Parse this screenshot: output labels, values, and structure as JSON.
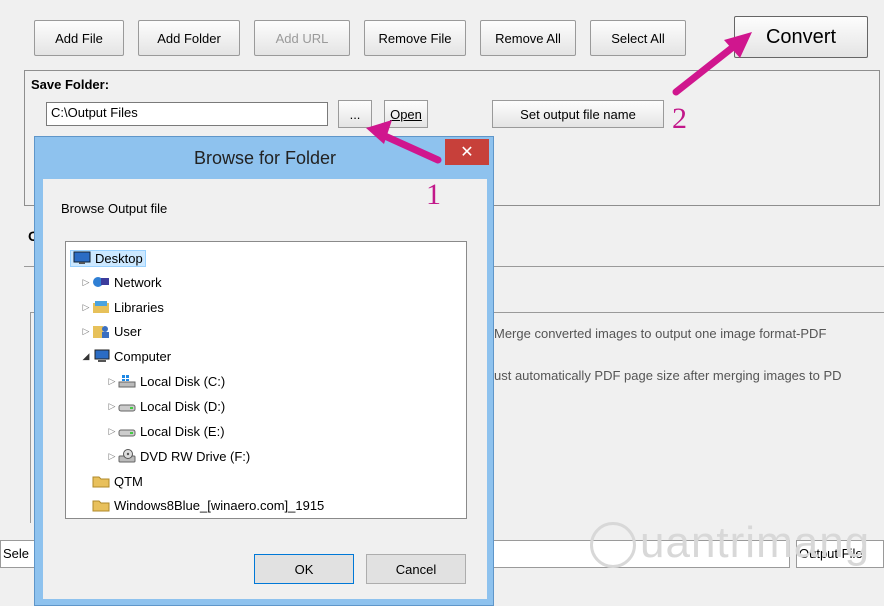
{
  "toolbar": {
    "add_file": "Add File",
    "add_folder": "Add Folder",
    "add_url": "Add URL",
    "remove_file": "Remove File",
    "remove_all": "Remove All",
    "select_all": "Select All",
    "convert": "Convert"
  },
  "save_folder": {
    "title": "Save Folder:",
    "path": "C:\\Output Files",
    "browse": "...",
    "open": "Open",
    "set_output_name": "Set output file name"
  },
  "section_cut_label": "O",
  "options": {
    "merge": "Merge converted images to output one image format-PDF",
    "adjust": "ust automatically PDF page size after merging images to PD"
  },
  "status": {
    "left": "Sele",
    "right": "Output File"
  },
  "dialog": {
    "title": "Browse for Folder",
    "close": "✕",
    "label": "Browse Output file",
    "tree": [
      {
        "label": "Desktop"
      },
      {
        "label": "Network"
      },
      {
        "label": "Libraries"
      },
      {
        "label": "User"
      },
      {
        "label": "Computer"
      },
      {
        "label": "Local Disk (C:)"
      },
      {
        "label": "Local Disk (D:)"
      },
      {
        "label": "Local Disk (E:)"
      },
      {
        "label": "DVD RW Drive (F:)"
      },
      {
        "label": "QTM"
      },
      {
        "label": "Windows8Blue_[winaero.com]_1915"
      }
    ],
    "ok": "OK",
    "cancel": "Cancel"
  },
  "annotations": {
    "one": "1",
    "two": "2"
  },
  "watermark": "uantrimang",
  "colors": {
    "arrow": "#d0168e",
    "selection": "#cce8ff",
    "close": "#c7403a",
    "dialog_frame": "#8ec2ee"
  }
}
